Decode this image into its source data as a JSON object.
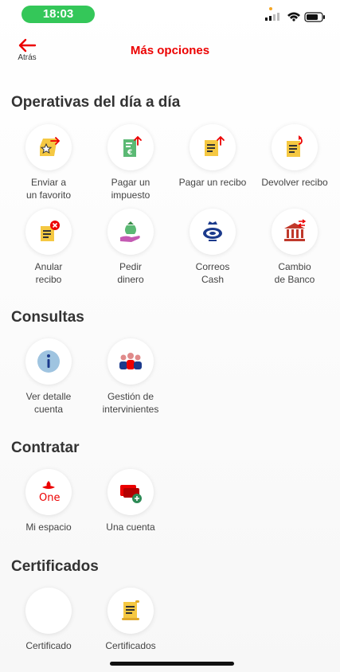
{
  "status_bar": {
    "time": "18:03"
  },
  "header": {
    "back_label": "Atrás",
    "title": "Más opciones"
  },
  "sections": {
    "operativas": {
      "title": "Operativas del día a día",
      "items": [
        {
          "label": "Enviar a\nun favorito",
          "icon": "favorite-send-icon"
        },
        {
          "label": "Pagar un\nimpuesto",
          "icon": "pay-tax-icon"
        },
        {
          "label": "Pagar un recibo",
          "icon": "pay-receipt-icon"
        },
        {
          "label": "Devolver recibo",
          "icon": "return-receipt-icon"
        },
        {
          "label": "Anular\nrecibo",
          "icon": "cancel-receipt-icon"
        },
        {
          "label": "Pedir\ndinero",
          "icon": "request-money-icon"
        },
        {
          "label": "Correos\nCash",
          "icon": "correos-cash-icon"
        },
        {
          "label": "Cambio\nde Banco",
          "icon": "bank-change-icon"
        }
      ]
    },
    "consultas": {
      "title": "Consultas",
      "items": [
        {
          "label": "Ver detalle\ncuenta",
          "icon": "info-icon"
        },
        {
          "label": "Gestión de\nintervinientes",
          "icon": "people-icon"
        }
      ]
    },
    "contratar": {
      "title": "Contratar",
      "items": [
        {
          "label": "Mi espacio",
          "icon": "santander-one-icon"
        },
        {
          "label": "Una cuenta",
          "icon": "new-account-icon"
        }
      ]
    },
    "certificados": {
      "title": "Certificados",
      "items": [
        {
          "label": "Certificado",
          "icon": "blank-icon"
        },
        {
          "label": "Certificados",
          "icon": "certificate-scroll-icon"
        }
      ]
    }
  },
  "colors": {
    "brand_red": "#ec0000",
    "status_green": "#34c759",
    "icon_yellow": "#f5c842",
    "icon_green": "#5bb974",
    "correos_blue": "#1b3a8c",
    "info_blue": "#9fc4e0"
  }
}
